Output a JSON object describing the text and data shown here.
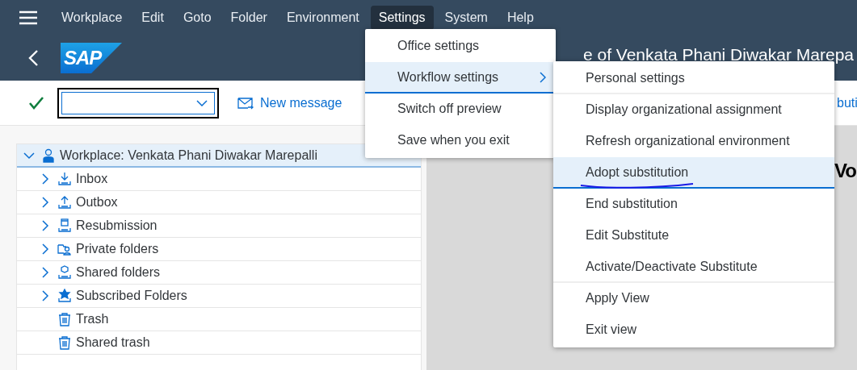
{
  "menu_bar": [
    {
      "label": "Workplace",
      "selected": false
    },
    {
      "label": "Edit",
      "selected": false
    },
    {
      "label": "Goto",
      "selected": false
    },
    {
      "label": "Folder",
      "selected": false
    },
    {
      "label": "Environment",
      "selected": false
    },
    {
      "label": "Settings",
      "selected": true
    },
    {
      "label": "System",
      "selected": false
    },
    {
      "label": "Help",
      "selected": false
    }
  ],
  "header": {
    "logo_text": "SAP",
    "title": "e of Venkata Phani Diwakar Marepa"
  },
  "toolbar": {
    "new_message": "New message",
    "cut_text": "buti"
  },
  "tree": {
    "label": "Workplace: Venkata Phani Diwakar Marepalli",
    "expanded": true,
    "selected": true,
    "children": [
      {
        "label": "Inbox",
        "kind": "inbox",
        "expanded": false
      },
      {
        "label": "Outbox",
        "kind": "outbox",
        "expanded": false
      },
      {
        "label": "Resubmission",
        "kind": "resubmission",
        "expanded": false
      },
      {
        "label": "Private folders",
        "kind": "private",
        "expanded": false
      },
      {
        "label": "Shared folders",
        "kind": "shared",
        "expanded": false
      },
      {
        "label": "Subscribed Folders",
        "kind": "subscribed",
        "expanded": false
      },
      {
        "label": "Trash",
        "kind": "trash"
      },
      {
        "label": "Shared trash",
        "kind": "trash"
      }
    ]
  },
  "detail": {
    "cut_heading": "Vo"
  },
  "settings_menu": [
    {
      "label": "Office settings",
      "selected": false,
      "submenu": false
    },
    {
      "label": "Workflow settings",
      "selected": true,
      "submenu": true
    },
    {
      "label": "Switch off preview",
      "selected": false,
      "submenu": false
    },
    {
      "label": "Save when you exit",
      "selected": false,
      "submenu": false
    }
  ],
  "workflow_submenu": [
    {
      "label": "Personal settings",
      "selected": false,
      "separator_after": true
    },
    {
      "label": "Display organizational assignment",
      "selected": false,
      "separator_after": false
    },
    {
      "label": "Refresh organizational environment",
      "selected": false,
      "separator_after": false
    },
    {
      "label": "Adopt substitution",
      "selected": true,
      "separator_after": false
    },
    {
      "label": "End substitution",
      "selected": false,
      "separator_after": false
    },
    {
      "label": "Edit Substitute",
      "selected": false,
      "separator_after": false
    },
    {
      "label": "Activate/Deactivate Substitute",
      "selected": false,
      "separator_after": true
    },
    {
      "label": "Apply View",
      "selected": false,
      "separator_after": false
    },
    {
      "label": "Exit view",
      "selected": false,
      "separator_after": false
    }
  ]
}
